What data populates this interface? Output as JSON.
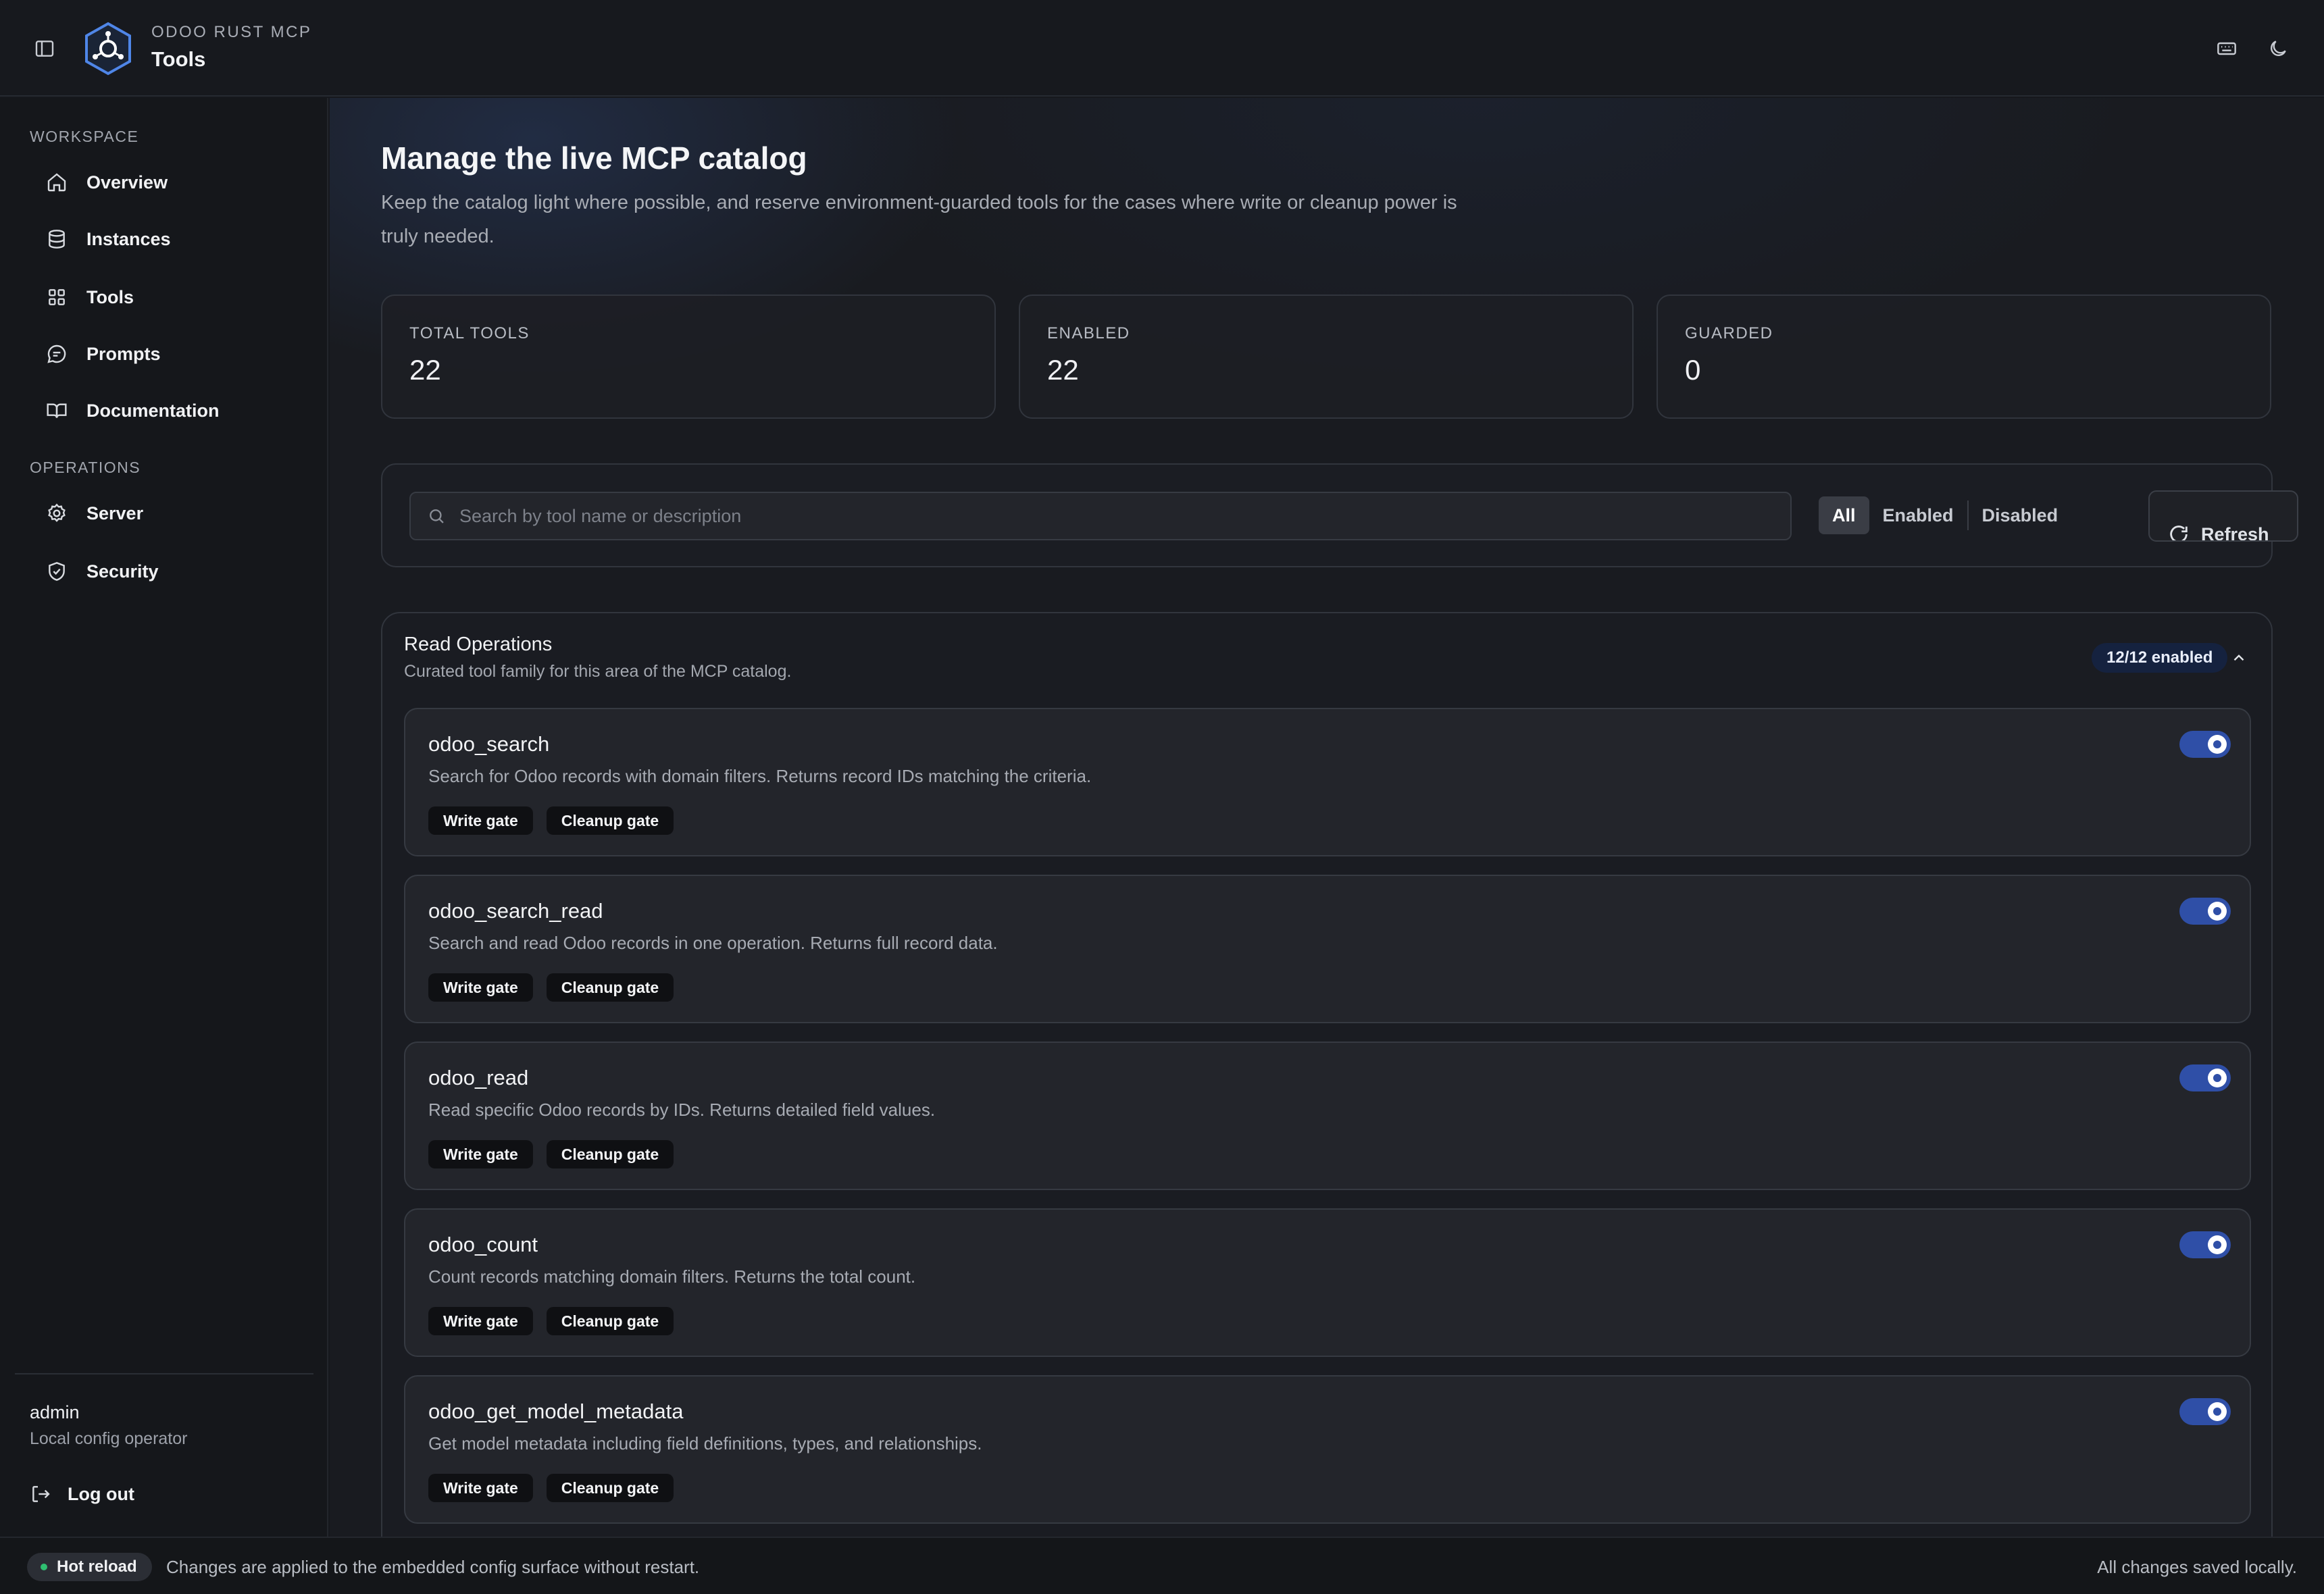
{
  "header": {
    "brand_small": "ODOO RUST MCP",
    "page": "Tools",
    "icons": [
      "sidebar-toggle-icon",
      "keyboard-icon",
      "moon-icon"
    ]
  },
  "sidebar": {
    "sections": [
      {
        "title": "WORKSPACE",
        "items": [
          {
            "label": "Overview",
            "icon": "home-icon"
          },
          {
            "label": "Instances",
            "icon": "database-icon"
          },
          {
            "label": "Tools",
            "icon": "grid-icon"
          },
          {
            "label": "Prompts",
            "icon": "chat-icon"
          },
          {
            "label": "Documentation",
            "icon": "book-icon"
          }
        ]
      },
      {
        "title": "OPERATIONS",
        "items": [
          {
            "label": "Server",
            "icon": "gear-icon"
          },
          {
            "label": "Security",
            "icon": "shield-icon"
          }
        ]
      }
    ],
    "user": {
      "name": "admin",
      "role": "Local config operator"
    },
    "logout_label": "Log out"
  },
  "main": {
    "title": "Manage the live MCP catalog",
    "description": "Keep the catalog light where possible, and reserve environment-guarded tools for the cases where write or cleanup power is truly needed.",
    "stats": [
      {
        "label": "TOTAL TOOLS",
        "value": "22"
      },
      {
        "label": "ENABLED",
        "value": "22"
      },
      {
        "label": "GUARDED",
        "value": "0"
      }
    ],
    "search": {
      "placeholder": "Search by tool name or description",
      "value": ""
    },
    "filters": {
      "options": [
        "All",
        "Enabled",
        "Disabled"
      ],
      "selected": "All"
    },
    "refresh_label": "Refresh",
    "group": {
      "title": "Read Operations",
      "subtitle": "Curated tool family for this area of the MCP catalog.",
      "badge": "12/12 enabled",
      "tools": [
        {
          "name": "odoo_search",
          "description": "Search for Odoo records with domain filters. Returns record IDs matching the criteria.",
          "tags": [
            "Write gate",
            "Cleanup gate"
          ],
          "enabled": true
        },
        {
          "name": "odoo_search_read",
          "description": "Search and read Odoo records in one operation. Returns full record data.",
          "tags": [
            "Write gate",
            "Cleanup gate"
          ],
          "enabled": true
        },
        {
          "name": "odoo_read",
          "description": "Read specific Odoo records by IDs. Returns detailed field values.",
          "tags": [
            "Write gate",
            "Cleanup gate"
          ],
          "enabled": true
        },
        {
          "name": "odoo_count",
          "description": "Count records matching domain filters. Returns the total count.",
          "tags": [
            "Write gate",
            "Cleanup gate"
          ],
          "enabled": true
        },
        {
          "name": "odoo_get_model_metadata",
          "description": "Get model metadata including field definitions, types, and relationships.",
          "tags": [
            "Write gate",
            "Cleanup gate"
          ],
          "enabled": true
        }
      ]
    }
  },
  "footer": {
    "badge": "Hot reload",
    "message": "Changes are applied to the embedded config surface without restart.",
    "status": "All changes saved locally."
  },
  "colors": {
    "accent": "#2f4fa7",
    "badge_bg": "#15223f",
    "success_dot": "#2fbf71"
  }
}
